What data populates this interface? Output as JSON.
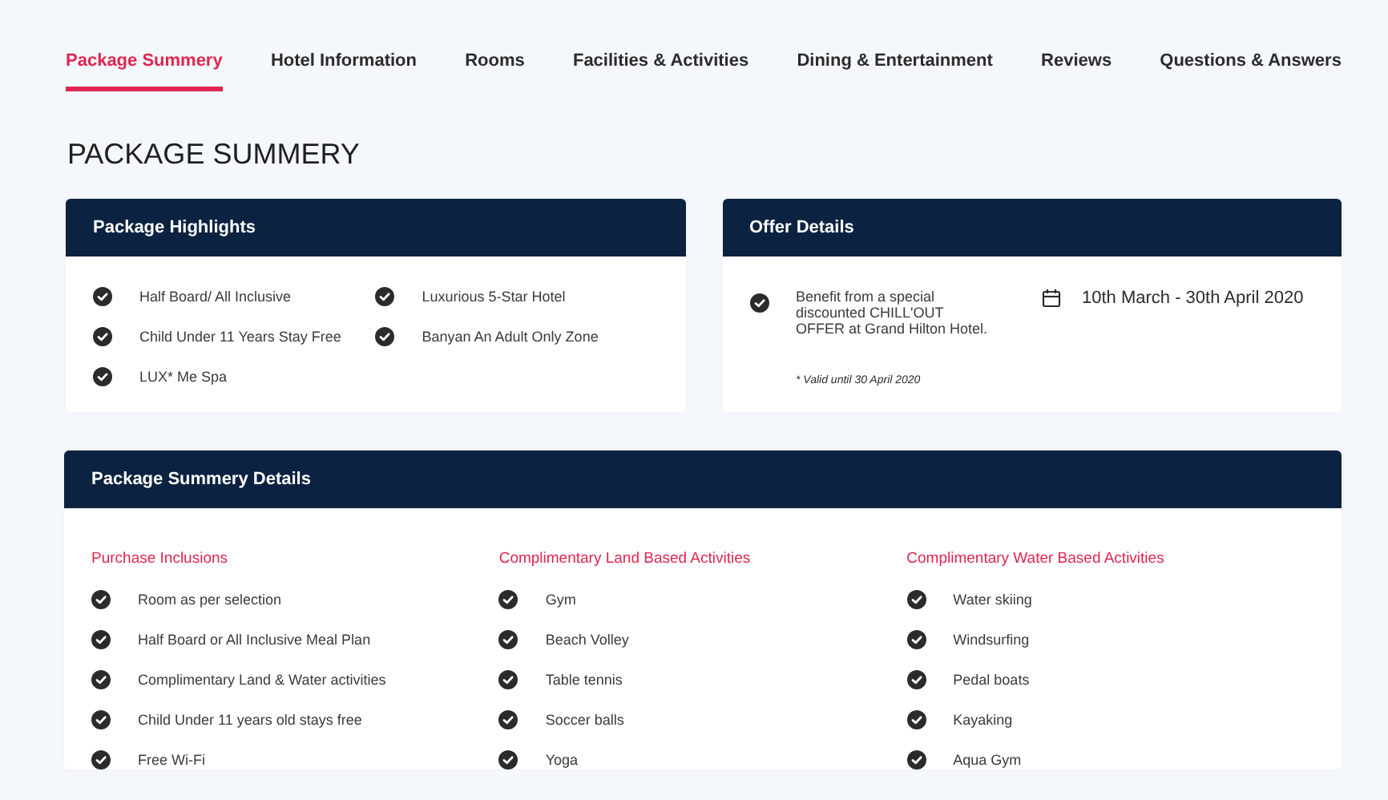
{
  "tabs": [
    {
      "label": "Package Summery",
      "selected": true
    },
    {
      "label": "Hotel Information",
      "selected": false
    },
    {
      "label": "Rooms",
      "selected": false
    },
    {
      "label": "Facilities & Activities",
      "selected": false
    },
    {
      "label": "Dining & Entertainment",
      "selected": false
    },
    {
      "label": "Reviews",
      "selected": false
    },
    {
      "label": "Questions & Answers",
      "selected": false
    }
  ],
  "page_title": "PACKAGE SUMMERY",
  "highlights": {
    "title": "Package Highlights",
    "items": [
      "Half Board/ All Inclusive",
      "Luxurious 5-Star Hotel",
      "Child Under 11 Years Stay Free",
      "Banyan An Adult Only Zone",
      "LUX* Me Spa"
    ]
  },
  "offer": {
    "title": "Offer Details",
    "text": "Benefit from a special discounted CHILL'OUT OFFER at Grand Hilton Hotel.",
    "dates": "10th March - 30th April 2020",
    "note": "* Valid until 30 April 2020"
  },
  "details": {
    "title": "Package Summery Details",
    "columns": [
      {
        "heading": "Purchase Inclusions",
        "items": [
          "Room as per selection",
          "Half Board or All Inclusive Meal Plan",
          "Complimentary Land & Water activities",
          "Child Under 11 years old stays free",
          "Free Wi-Fi"
        ]
      },
      {
        "heading": "Complimentary Land Based Activities",
        "items": [
          "Gym",
          "Beach Volley",
          "Table tennis",
          "Soccer balls",
          "Yoga"
        ]
      },
      {
        "heading": "Complimentary Water Based Activities",
        "items": [
          "Water skiing",
          "Windsurfing",
          "Pedal boats",
          "Kayaking",
          "Aqua Gym"
        ]
      }
    ]
  }
}
